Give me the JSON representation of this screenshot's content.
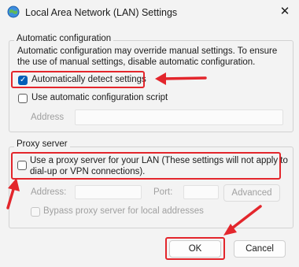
{
  "window": {
    "title": "Local Area Network (LAN) Settings",
    "close_glyph": "✕"
  },
  "auto_config": {
    "legend": "Automatic configuration",
    "description": "Automatic configuration may override manual settings.  To ensure the use of manual settings, disable automatic configuration.",
    "detect_label": "Automatically detect settings",
    "detect_checked": true,
    "script_label": "Use automatic configuration script",
    "script_checked": false,
    "address_label": "Address",
    "address_value": ""
  },
  "proxy": {
    "legend": "Proxy server",
    "use_proxy_label_line1": "Use a proxy server for your LAN (These settings will not apply to",
    "use_proxy_label_line2": "dial-up or VPN connections).",
    "use_proxy_checked": false,
    "address_label": "Address:",
    "address_value": "",
    "port_label": "Port:",
    "port_value": "",
    "advanced_label": "Advanced",
    "bypass_label": "Bypass proxy server for local addresses",
    "bypass_checked": false
  },
  "buttons": {
    "ok": "OK",
    "cancel": "Cancel"
  },
  "colors": {
    "annotation": "#e3262c",
    "accent": "#005fb8",
    "background": "#f3f3f3"
  },
  "icons": {
    "app": "network-globe-icon",
    "close": "close-icon"
  }
}
